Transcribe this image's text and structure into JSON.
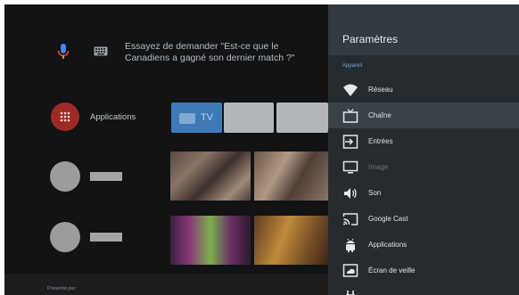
{
  "search": {
    "prompt": "Essayez de demander \"Est-ce que le Canadiens a gagné son dernier match ?\""
  },
  "apps_row": {
    "label": "Applications",
    "tv_tile_label": "TV"
  },
  "footer": {
    "presented_by": "Présenté par"
  },
  "settings": {
    "title": "Paramètres",
    "section": "Appareil",
    "items": [
      {
        "label": "Réseau",
        "icon": "wifi-icon",
        "selected": false,
        "disabled": false
      },
      {
        "label": "Chaîne",
        "icon": "tv-icon",
        "selected": true,
        "disabled": false
      },
      {
        "label": "Entrées",
        "icon": "input-icon",
        "selected": false,
        "disabled": false
      },
      {
        "label": "Image",
        "icon": "monitor-icon",
        "selected": false,
        "disabled": true
      },
      {
        "label": "Son",
        "icon": "speaker-icon",
        "selected": false,
        "disabled": false
      },
      {
        "label": "Google Cast",
        "icon": "cast-icon",
        "selected": false,
        "disabled": false
      },
      {
        "label": "Applications",
        "icon": "android-icon",
        "selected": false,
        "disabled": false
      },
      {
        "label": "Écran de veille",
        "icon": "screensaver-icon",
        "selected": false,
        "disabled": false
      }
    ]
  },
  "colors": {
    "panel_bg": "#262b2f",
    "panel_header_bg": "#333a40",
    "selected_row": "#3a4249",
    "section_accent": "#7fa3c8",
    "apps_icon_red": "#9e2a25",
    "tv_tile_blue": "#3f7ab8"
  }
}
